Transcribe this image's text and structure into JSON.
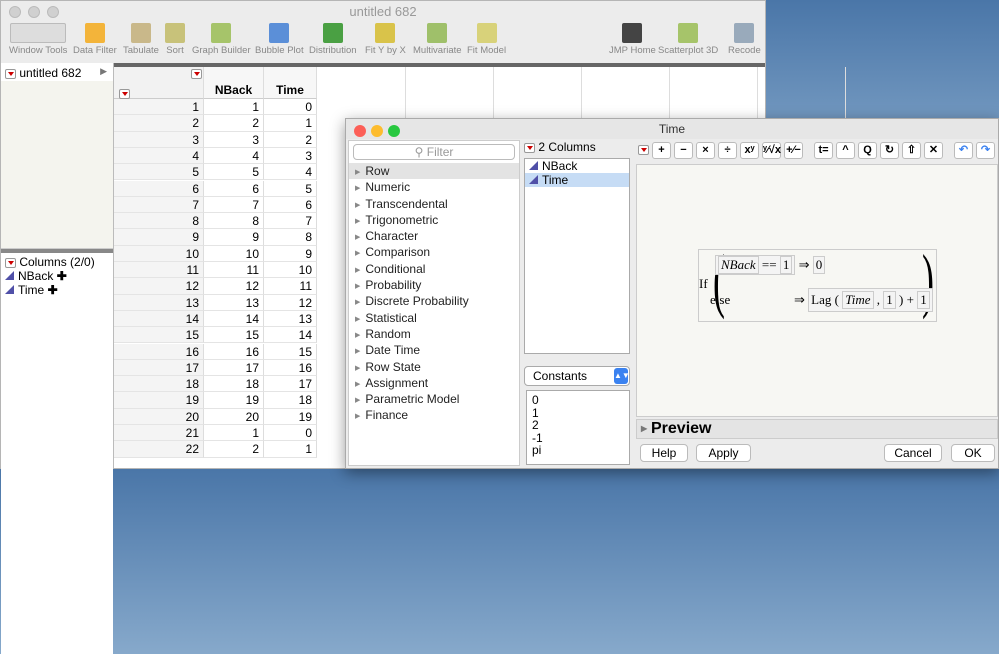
{
  "window": {
    "title": "untitled 682"
  },
  "toolbar": [
    {
      "label": "Window Tools",
      "icon": "pointer-help-icon"
    },
    {
      "label": "Data Filter",
      "icon": "data-filter-icon"
    },
    {
      "label": "Tabulate",
      "icon": "tabulate-icon"
    },
    {
      "label": "Sort",
      "icon": "sort-icon"
    },
    {
      "label": "Graph Builder",
      "icon": "graph-builder-icon"
    },
    {
      "label": "Bubble Plot",
      "icon": "bubble-plot-icon"
    },
    {
      "label": "Distribution",
      "icon": "distribution-icon"
    },
    {
      "label": "Fit Y by X",
      "icon": "fit-y-by-x-icon"
    },
    {
      "label": "Multivariate",
      "icon": "multivariate-icon"
    },
    {
      "label": "Fit Model",
      "icon": "fit-model-icon"
    },
    {
      "label": "JMP Home",
      "icon": "home-icon"
    },
    {
      "label": "Scatterplot 3D",
      "icon": "scatterplot-3d-icon"
    },
    {
      "label": "Recode",
      "icon": "recode-icon"
    }
  ],
  "table_panel": {
    "name": "untitled 682"
  },
  "columns_panel": {
    "title": "Columns (2/0)",
    "columns": [
      "NBack",
      "Time"
    ]
  },
  "grid": {
    "headers": [
      "NBack",
      "Time"
    ],
    "rows": [
      [
        1,
        1,
        0
      ],
      [
        2,
        2,
        1
      ],
      [
        3,
        3,
        2
      ],
      [
        4,
        4,
        3
      ],
      [
        5,
        5,
        4
      ],
      [
        6,
        6,
        5
      ],
      [
        7,
        7,
        6
      ],
      [
        8,
        8,
        7
      ],
      [
        9,
        9,
        8
      ],
      [
        10,
        10,
        9
      ],
      [
        11,
        11,
        10
      ],
      [
        12,
        12,
        11
      ],
      [
        13,
        13,
        12
      ],
      [
        14,
        14,
        13
      ],
      [
        15,
        15,
        14
      ],
      [
        16,
        16,
        15
      ],
      [
        17,
        17,
        16
      ],
      [
        18,
        18,
        17
      ],
      [
        19,
        19,
        18
      ],
      [
        20,
        20,
        19
      ],
      [
        21,
        1,
        0
      ],
      [
        22,
        2,
        1
      ]
    ]
  },
  "dialog": {
    "title": "Time",
    "filter_placeholder": "Filter",
    "functions": [
      "Row",
      "Numeric",
      "Transcendental",
      "Trigonometric",
      "Character",
      "Comparison",
      "Conditional",
      "Probability",
      "Discrete Probability",
      "Statistical",
      "Random",
      "Date Time",
      "Row State",
      "Assignment",
      "Parametric Model",
      "Finance"
    ],
    "columns_header": "2 Columns",
    "columns": [
      "NBack",
      "Time"
    ],
    "selected_column": "Time",
    "constants_select": "Constants",
    "constants": [
      "0",
      "1",
      "2",
      "-1",
      "pi"
    ],
    "formula_buttons": [
      "+",
      "−",
      "×",
      "÷",
      "xʸ",
      "ʸ⁄√x",
      "+⁄−",
      "t=",
      "^",
      "Q",
      "↻",
      "⇧",
      "✕",
      "↶",
      "↷"
    ],
    "formula": {
      "fn": "If",
      "cond_col": "NBack",
      "op": "==",
      "cond_val": "1",
      "arrow": "⇒",
      "then": "0",
      "else": "else",
      "lag": "Lag",
      "lag_col": "Time",
      "lag_n": "1",
      "plus": "+",
      "add": "1"
    },
    "preview": "Preview",
    "buttons": {
      "help": "Help",
      "apply": "Apply",
      "cancel": "Cancel",
      "ok": "OK"
    }
  }
}
